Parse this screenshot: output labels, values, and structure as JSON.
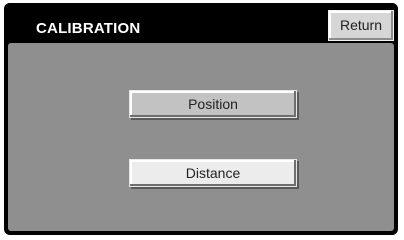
{
  "header": {
    "title": "CALIBRATION",
    "return_label": "Return"
  },
  "menu": {
    "position_label": "Position",
    "distance_label": "Distance"
  },
  "colors": {
    "title_bar": "#000000",
    "panel": "#8f8f8f",
    "button_face": "#c2c2c2",
    "button_highlight": "#ececec"
  }
}
